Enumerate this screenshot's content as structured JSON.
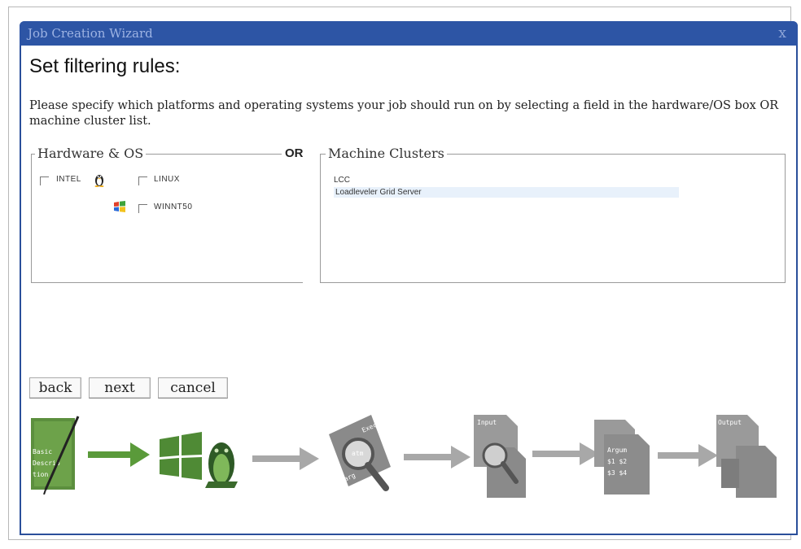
{
  "window": {
    "title": "Job Creation Wizard",
    "close_label": "x"
  },
  "heading": "Set filtering rules:",
  "description": "Please specify which platforms and operating systems your job should run on by selecting a field in the hardware/OS box OR machine cluster list.",
  "hardware_os": {
    "legend": "Hardware & OS",
    "arch_label": "INTEL",
    "options": [
      {
        "label": "LINUX",
        "icon": "linux-penguin-icon",
        "checked": false
      },
      {
        "label": "WINNT50",
        "icon": "windows-logo-icon",
        "checked": false
      }
    ]
  },
  "or_label": "OR",
  "machine_clusters": {
    "legend": "Machine Clusters",
    "items": [
      {
        "label": "LCC",
        "selected": false
      },
      {
        "label": "Loadleveler Grid Server",
        "selected": true
      }
    ]
  },
  "buttons": {
    "back": "back",
    "next": "next",
    "cancel": "cancel"
  },
  "steps": [
    {
      "name": "job-description-step",
      "icon": "job-description-icon",
      "text_lines": [
        "Basic",
        "Descrip",
        "tion"
      ]
    },
    {
      "name": "platform-step",
      "icon": "platform-windows-linux-icon",
      "text_lines": []
    },
    {
      "name": "search-step",
      "icon": "search-executable-icon",
      "text_lines": [
        "Exec",
        "atm",
        "arg"
      ]
    },
    {
      "name": "input-files-step",
      "icon": "input-files-icon",
      "text_lines": [
        "Input"
      ]
    },
    {
      "name": "arguments-step",
      "icon": "arguments-icon",
      "text_lines": [
        "Argum",
        "$1 $2",
        "$3 $4"
      ]
    },
    {
      "name": "output-files-step",
      "icon": "output-files-icon",
      "text_lines": [
        "Output"
      ]
    }
  ],
  "colors": {
    "titlebar": "#2d55a5",
    "arrow_green": "#5a9a3a",
    "arrow_gray": "#a8a8a8",
    "step_gray": "#8f8f8f"
  }
}
